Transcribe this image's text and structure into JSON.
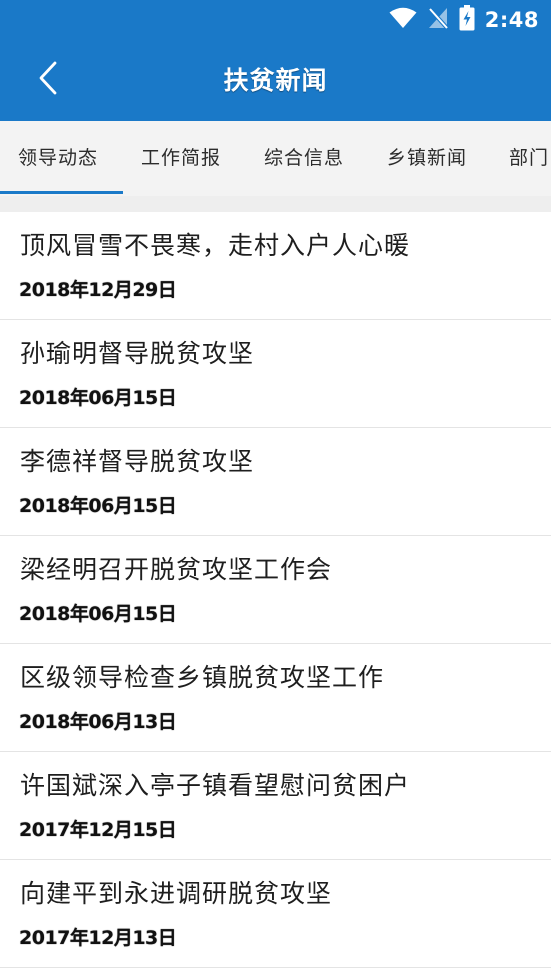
{
  "status_bar": {
    "time": "2:48",
    "icons": [
      "wifi-icon",
      "no-signal-icon",
      "battery-charging-icon"
    ]
  },
  "header": {
    "title": "扶贫新闻",
    "back_icon": "chevron-left-icon"
  },
  "colors": {
    "primary": "#1a79c8",
    "tab_bg": "#f3f3f3",
    "divider": "#e4e4e4"
  },
  "tabs": [
    {
      "label": "领导动态",
      "selected": true
    },
    {
      "label": "工作简报",
      "selected": false
    },
    {
      "label": "综合信息",
      "selected": false
    },
    {
      "label": "乡镇新闻",
      "selected": false
    },
    {
      "label": "部门",
      "selected": false
    }
  ],
  "news": [
    {
      "title": "顶风冒雪不畏寒，走村入户人心暖",
      "date": "2018年12月29日"
    },
    {
      "title": "孙瑜明督导脱贫攻坚",
      "date": "2018年06月15日"
    },
    {
      "title": "李德祥督导脱贫攻坚",
      "date": "2018年06月15日"
    },
    {
      "title": "梁经明召开脱贫攻坚工作会",
      "date": "2018年06月15日"
    },
    {
      "title": "区级领导检查乡镇脱贫攻坚工作",
      "date": "2018年06月13日"
    },
    {
      "title": "许国斌深入亭子镇看望慰问贫困户",
      "date": "2017年12月15日"
    },
    {
      "title": "向建平到永进调研脱贫攻坚",
      "date": "2017年12月13日"
    }
  ]
}
